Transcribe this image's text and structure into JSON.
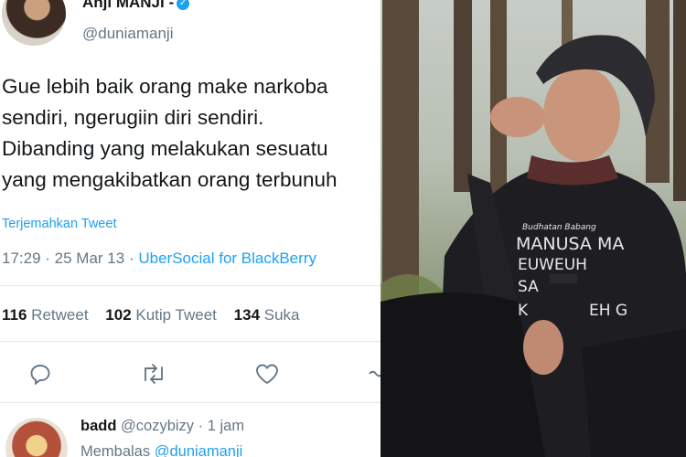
{
  "tweet": {
    "display_name": "Anji MANJI -",
    "handle": "@duniamanji",
    "text_lines": [
      "Gue lebih baik orang make narkoba",
      "sendiri, ngerugiin diri sendiri.",
      "Dibanding yang melakukan sesuatu",
      "yang mengakibatkan orang terbunuh"
    ],
    "translate_label": "Terjemahkan Tweet",
    "time": "17:29",
    "date": "25 Mar 13",
    "via": "UberSocial for BlackBerry",
    "stats": {
      "retweets_count": "116",
      "retweets_label": "Retweet",
      "quotes_count": "102",
      "quotes_label": "Kutip Tweet",
      "likes_count": "134",
      "likes_label": "Suka"
    },
    "actions": [
      "reply-icon",
      "retweet-icon",
      "like-icon",
      "share-icon"
    ],
    "accent_color": "#1da1f2"
  },
  "reply": {
    "name": "badd",
    "handle": "@cozybizy",
    "time": "1 jam",
    "replying_label": "Membalas",
    "replying_to": "@duniamanji"
  },
  "photo": {
    "shirt_lines": [
      "Budhatan Babang",
      "MANUSA MA",
      "EUWEUH",
      "SA",
      "K",
      "EH G"
    ]
  }
}
